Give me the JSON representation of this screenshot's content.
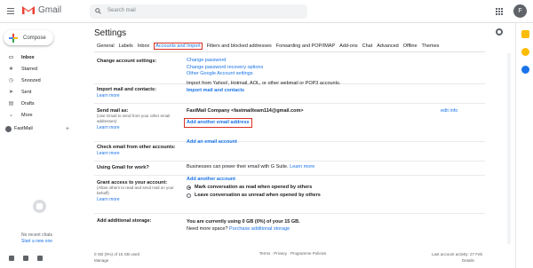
{
  "app": {
    "name": "Gmail",
    "avatar_letter": "F"
  },
  "search": {
    "placeholder": "Search mail"
  },
  "compose": {
    "label": "Compose"
  },
  "nav": [
    {
      "label": "Inbox",
      "icon": "inbox-icon",
      "bold": true
    },
    {
      "label": "Starred",
      "icon": "star-icon"
    },
    {
      "label": "Snoozed",
      "icon": "clock-icon"
    },
    {
      "label": "Sent",
      "icon": "send-icon"
    },
    {
      "label": "Drafts",
      "icon": "draft-icon"
    },
    {
      "label": "More",
      "icon": "chevron-down-icon"
    }
  ],
  "account": {
    "name": "FastMail"
  },
  "chat": {
    "no_chats": "No recent chats",
    "start_new": "Start a new one"
  },
  "settings": {
    "title": "Settings",
    "tabs": [
      "General",
      "Labels",
      "Inbox",
      "Accounts and Import",
      "Filters and blocked addresses",
      "Forwarding and POP/IMAP",
      "Add-ons",
      "Chat",
      "Advanced",
      "Offline",
      "Themes"
    ],
    "active_tab": "Accounts and Import",
    "sections": {
      "change_account": {
        "label": "Change account settings:",
        "links": [
          "Change password",
          "Change password recovery options",
          "Other Google Account settings"
        ]
      },
      "import": {
        "label": "Import mail and contacts:",
        "learn": "Learn more",
        "text": "Import from Yahoo!, Hotmail, AOL, or other webmail or POP3 accounts.",
        "link": "Import mail and contacts"
      },
      "send_as": {
        "label": "Send mail as:",
        "sub": "(Use Gmail to send from your other email addresses)",
        "learn": "Learn more",
        "identity": "FastMail Company <fastmailteam114@gmail.com>",
        "edit": "edit info",
        "add_link": "Add another email address"
      },
      "check_other": {
        "label": "Check email from other accounts:",
        "learn": "Learn more",
        "link": "Add an email account"
      },
      "work": {
        "label": "Using Gmail for work?",
        "text": "Businesses can power their email with G Suite.",
        "learn": "Learn more"
      },
      "grant": {
        "label": "Grant access to your account:",
        "sub": "(Allow others to read and send mail on your behalf)",
        "learn": "Learn more",
        "link": "Add another account",
        "option_read": "Mark conversation as read when opened by others",
        "option_unread": "Leave conversation as unread when opened by others"
      },
      "storage": {
        "label": "Add additional storage:",
        "text": "You are currently using 0 GB (0%) of your 15 GB.",
        "need_more": "Need more space?",
        "purchase": "Purchase additional storage"
      }
    }
  },
  "footer": {
    "usage": "0 GB (0%) of 15 GB used",
    "manage": "Manage",
    "links": "Terms · Privacy · Programme Policies",
    "activity": "Last account activity: 27 Feb",
    "details": "Details"
  },
  "colors": {
    "accent": "#1a73e8",
    "highlight": "#d93025",
    "gmail_red": "#ea4335"
  }
}
